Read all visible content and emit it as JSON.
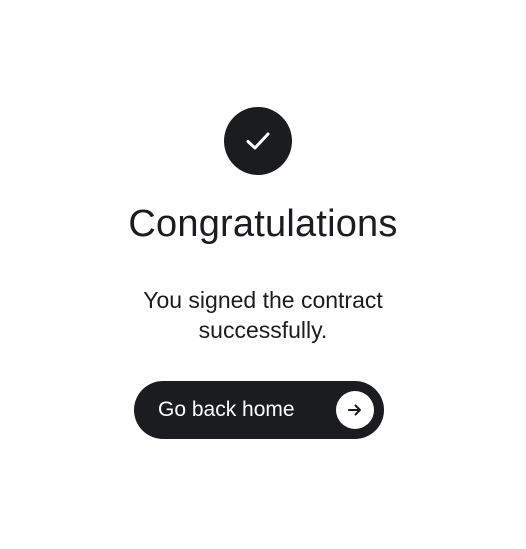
{
  "success_screen": {
    "icon": "checkmark-icon",
    "title": "Congratulations",
    "message": "You signed the contract successfully.",
    "button": {
      "label": "Go back home",
      "icon": "arrow-right-icon"
    }
  },
  "colors": {
    "primary": "#1b1c20",
    "background": "#ffffff",
    "button_text": "#ffffff"
  }
}
